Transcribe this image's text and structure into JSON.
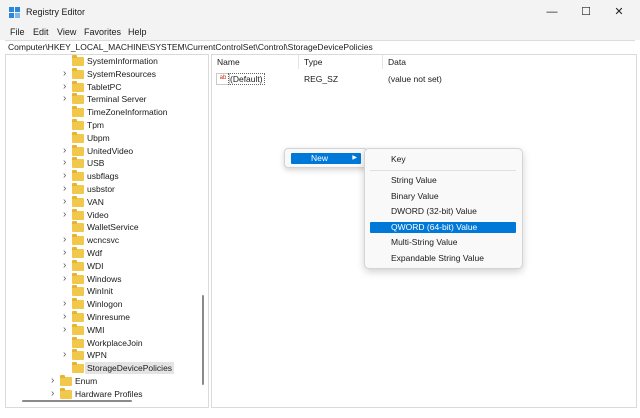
{
  "window": {
    "title": "Registry Editor",
    "minimize": "—",
    "maximize": "☐",
    "close": "✕"
  },
  "menu": [
    "File",
    "Edit",
    "View",
    "Favorites",
    "Help"
  ],
  "address": "Computer\\HKEY_LOCAL_MACHINE\\SYSTEM\\CurrentControlSet\\Control\\StorageDevicePolicies",
  "tree": [
    {
      "label": "SystemInformation",
      "expandable": false
    },
    {
      "label": "SystemResources",
      "expandable": true
    },
    {
      "label": "TabletPC",
      "expandable": true
    },
    {
      "label": "Terminal Server",
      "expandable": true
    },
    {
      "label": "TimeZoneInformation",
      "expandable": false
    },
    {
      "label": "Tpm",
      "expandable": false
    },
    {
      "label": "Ubpm",
      "expandable": false
    },
    {
      "label": "UnitedVideo",
      "expandable": true
    },
    {
      "label": "USB",
      "expandable": true
    },
    {
      "label": "usbflags",
      "expandable": true
    },
    {
      "label": "usbstor",
      "expandable": true
    },
    {
      "label": "VAN",
      "expandable": true
    },
    {
      "label": "Video",
      "expandable": true
    },
    {
      "label": "WalletService",
      "expandable": false
    },
    {
      "label": "wcncsvc",
      "expandable": true
    },
    {
      "label": "Wdf",
      "expandable": true
    },
    {
      "label": "WDI",
      "expandable": true
    },
    {
      "label": "Windows",
      "expandable": true
    },
    {
      "label": "WinInit",
      "expandable": false
    },
    {
      "label": "Winlogon",
      "expandable": true
    },
    {
      "label": "Winresume",
      "expandable": true
    },
    {
      "label": "WMI",
      "expandable": true
    },
    {
      "label": "WorkplaceJoin",
      "expandable": false
    },
    {
      "label": "WPN",
      "expandable": true
    },
    {
      "label": "StorageDevicePolicies",
      "expandable": false,
      "selected": true
    },
    {
      "label": "Enum",
      "expandable": true,
      "level": 0
    },
    {
      "label": "Hardware Profiles",
      "expandable": true,
      "level": 0
    }
  ],
  "columns": {
    "name": "Name",
    "type": "Type",
    "data": "Data"
  },
  "values": [
    {
      "name": "(Default)",
      "type": "REG_SZ",
      "data": "(value not set)",
      "icon": "ab"
    }
  ],
  "context_menu": {
    "new_label": "New",
    "arrow": "▶"
  },
  "submenu": {
    "key": "Key",
    "items": [
      "String Value",
      "Binary Value",
      "DWORD (32-bit) Value",
      "QWORD (64-bit) Value",
      "Multi-String Value",
      "Expandable String Value"
    ],
    "highlighted_index": 3
  },
  "colors": {
    "accent": "#0078d7",
    "folder": "#f1c84b",
    "chrome": "#f3f3f3"
  }
}
